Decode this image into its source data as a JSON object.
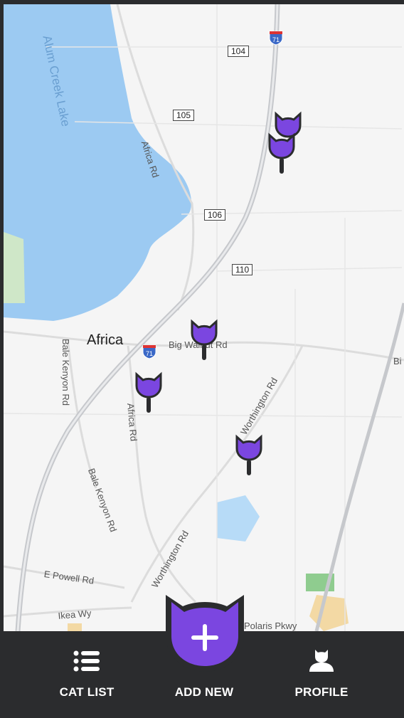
{
  "map": {
    "lake_label": "Alum Creek Lake",
    "place_label": "Africa",
    "road_labels": [
      "Africa Rd",
      "Big Walnut Rd",
      "Bale Kenyon Rd",
      "Africa Rd",
      "Bale Kenyon Rd",
      "Worthington Rd",
      "Worthington Rd",
      "E Powell Rd",
      "Ikea Wy",
      "Polaris Pkwy",
      "Bi"
    ],
    "route_shields": [
      "104",
      "105",
      "106",
      "110"
    ],
    "interstate_shields": [
      "71",
      "71"
    ],
    "pin_icon": "cat-marker-icon",
    "pin_color": "#7b46e0",
    "pin_count": 5
  },
  "nav": {
    "items": [
      {
        "label": "CAT LIST",
        "icon": "list-icon"
      },
      {
        "label": "ADD NEW",
        "icon": "plus-icon"
      },
      {
        "label": "PROFILE",
        "icon": "cat-profile-icon"
      }
    ],
    "accent": "#7b46e0",
    "bar_color": "#2b2c2e"
  }
}
